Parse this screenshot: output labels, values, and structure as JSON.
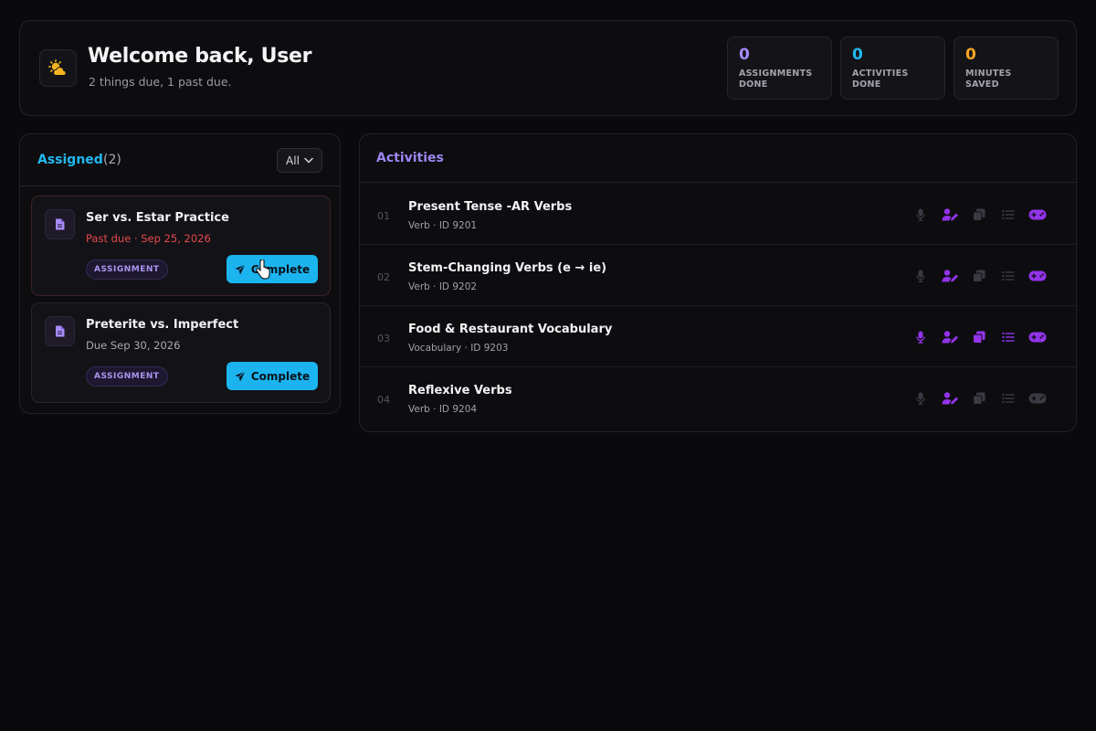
{
  "header": {
    "welcome": "Welcome back, User",
    "subtitle": "2 things due, 1 past due.",
    "icon": "weather-sun-cloud-icon",
    "stats": [
      {
        "value": "0",
        "label": "ASSIGNMENTS DONE",
        "color": "#a78bfa"
      },
      {
        "value": "0",
        "label": "ACTIVITIES DONE",
        "color": "#22b8f0"
      },
      {
        "value": "0",
        "label": "MINUTES SAVED",
        "color": "#f5a524"
      }
    ]
  },
  "assigned": {
    "title": "Assigned",
    "count": "(2)",
    "filter": "All",
    "cards": [
      {
        "title": "Ser vs. Estar Practice",
        "due": "Past due · Sep 25, 2026",
        "badge": "ASSIGNMENT",
        "button": "Complete",
        "past_due": true
      },
      {
        "title": "Preterite vs. Imperfect",
        "due": "Due Sep 30, 2026",
        "badge": "ASSIGNMENT",
        "button": "Complete",
        "past_due": false
      }
    ]
  },
  "activities": {
    "title": "Activities",
    "rows": [
      {
        "num": "01",
        "name": "Present Tense -AR Verbs",
        "meta": "Verb · ID 9201",
        "active_icons": [
          false,
          true,
          false,
          false,
          true
        ]
      },
      {
        "num": "02",
        "name": "Stem-Changing Verbs (e → ie)",
        "meta": "Verb · ID 9202",
        "active_icons": [
          false,
          true,
          false,
          false,
          true
        ]
      },
      {
        "num": "03",
        "name": "Food & Restaurant Vocabulary",
        "meta": "Vocabulary · ID 9203",
        "active_icons": [
          true,
          true,
          true,
          true,
          true
        ]
      },
      {
        "num": "04",
        "name": "Reflexive Verbs",
        "meta": "Verb · ID 9204",
        "active_icons": [
          false,
          true,
          false,
          false,
          false
        ]
      }
    ],
    "icon_names": [
      "microphone-icon",
      "user-edit-icon",
      "copy-cards-icon",
      "list-icon",
      "gamepad-icon"
    ]
  },
  "colors": {
    "accent_blue": "#22b8f0",
    "accent_purple": "#9d86f2",
    "icon_active": "#9333ea",
    "icon_inactive": "#3a3a42",
    "danger": "#e5484d"
  }
}
